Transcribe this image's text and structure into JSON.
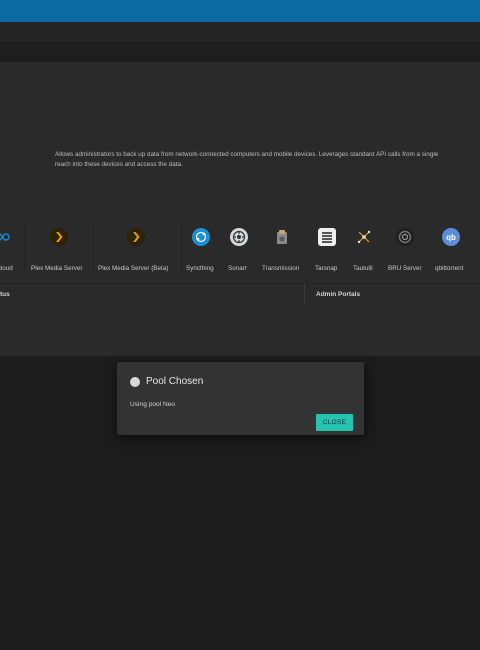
{
  "plugin": {
    "description_line1": "Allows administrators to back up data from network-connected computers and mobile devices. Leverages standard API calls from a single",
    "description_line2": "reach into these devices and access the data."
  },
  "plugins": [
    {
      "name": "tcloud",
      "icon": "nextcloud-icon",
      "color": "#1a84c6"
    },
    {
      "name": "Plex Media Server",
      "icon": "plex-icon",
      "color": "#e5a00d"
    },
    {
      "name": "Plex Media Server (Beta)",
      "icon": "plex-beta-icon",
      "color": "#e5a00d"
    },
    {
      "name": "Syncthing",
      "icon": "syncthing-icon",
      "color": "#1a8fd1"
    },
    {
      "name": "Sonarr",
      "icon": "sonarr-icon",
      "color": "#cfd8dc"
    },
    {
      "name": "Transmission",
      "icon": "transmission-icon",
      "color": "#b5b5b5"
    },
    {
      "name": "Tarsnap",
      "icon": "tarsnap-icon",
      "color": "#eeeeee"
    },
    {
      "name": "Tautulli",
      "icon": "tautulli-icon",
      "color": "#e5a00d"
    },
    {
      "name": "BRU Server",
      "icon": "bru-server-icon",
      "color": "#888888"
    },
    {
      "name": "qbittorrent",
      "icon": "qbittorrent-icon",
      "color": "#5b8ed6"
    }
  ],
  "table": {
    "status_header": "tus",
    "admin_header": "Admin Portals"
  },
  "dialog": {
    "title": "Pool Chosen",
    "message": "Using pool Neo",
    "close_label": "CLOSE"
  }
}
